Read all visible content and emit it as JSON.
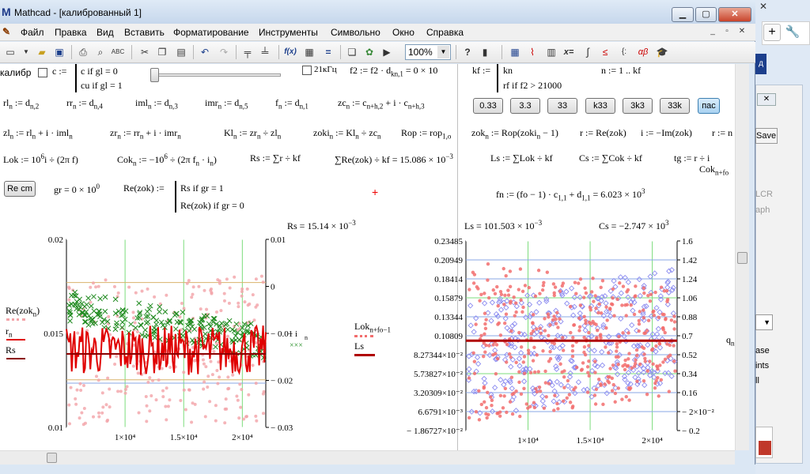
{
  "window": {
    "app_icon": "M",
    "title": "Mathcad - [калиброванный 1]",
    "min_label": "▁",
    "max_label": "▢",
    "close_label": "✕"
  },
  "menu": {
    "doc_icon": "✎",
    "items": [
      "Файл",
      "Правка",
      "Вид",
      "Вставить",
      "Форматирование",
      "Инструменты",
      "Символьно",
      "Окно",
      "Справка"
    ],
    "mdi_buttons": [
      "_",
      "▫",
      "✕"
    ]
  },
  "toolbar": {
    "zoom": "100%",
    "icons": [
      "new-doc-icon",
      "open-icon",
      "save-icon",
      "print-icon",
      "print-preview-icon",
      "spell-check-icon",
      "cut-icon",
      "copy-icon",
      "paste-icon",
      "undo-icon",
      "redo-icon",
      "align-icon",
      "align-down-icon",
      "insert-function-icon",
      "insert-unit-icon",
      "calculate-icon",
      "component-icon",
      "resource-icon",
      "help-icon",
      "run-icon",
      "calculator-icon",
      "graph-icon",
      "matrix-icon",
      "evaluation-icon",
      "calculus-icon",
      "boolean-icon",
      "programming-icon",
      "greek-icon",
      "symbolic-icon"
    ]
  },
  "sheet": {
    "kalibr_label": "калибр",
    "c_def_1": "c if gl = 0",
    "c_def_2": "cu if gl = 1",
    "c_prefix": "c :=",
    "check_21": "21кГц",
    "f2_def": "f2 := f2 · d",
    "f2_sub": "kn,1",
    "f2_tail": "= 0 × 10",
    "kf_prefix": "kf :=",
    "kf_def_1": "kn",
    "kf_def_2": "rf if f2 > 21000",
    "n_range": "n := 1 .. kf",
    "row2": {
      "rl": "rl",
      "rl_def": ":= d",
      "rr": "rr",
      "rr_def": ":= d",
      "iml": "iml",
      "iml_def": ":= d",
      "imr": "imr",
      "imr_def": ":= d",
      "f": "f",
      "f_def": ":= d",
      "zc": "zc",
      "zc_def": ":= c",
      "zc_mid": "+ i · c",
      "sub_n2": "n,2",
      "sub_n4": "n,4",
      "sub_n3": "n,3",
      "sub_n5": "n,5",
      "sub_n1": "n,1",
      "sub_nh2": "n+h,2",
      "sub_nh3": "n+h,3"
    },
    "buttons": [
      "0.33",
      "3.3",
      "33",
      "k33",
      "3k3",
      "33k",
      "пас"
    ],
    "row3": {
      "zl": "zl",
      "zl_def": ":= rl",
      "zl_tail": "+ i · iml",
      "zr": "zr",
      "zr_def": ":= rr",
      "zr_tail": "+ i · imr",
      "kl": "Kl",
      "kl_def": ":= zr",
      "kl_tail": "÷ zl",
      "zoki": "zoki",
      "zoki_def": ":= Kl",
      "zoki_tail": "÷ zc",
      "rop": "Rop := rop",
      "rop_sub": "1,o",
      "zok": "zok",
      "zok_def": ":= Rop(zoki",
      "zok_tail": "− 1)",
      "r_def": "r := Re(zok)",
      "i_def": "i := −Im(zok)",
      "rr2": "r :=",
      "n": "n"
    },
    "row4": {
      "lok": "Lok := 10",
      "lok_exp": "6",
      "lok_tail": "i ÷ (2π f)",
      "cok": "Cok",
      "cok_def": ":= −10",
      "cok_exp": "6",
      "cok_tail": "÷ (2π f",
      "cok_end": "· i",
      "rs": "Rs := ∑r ÷ kf",
      "sum_re": "∑Re(zok) ÷ kf = 15.086 × 10",
      "sum_re_exp": "−3",
      "ls": "Ls := ∑Lok ÷ kf",
      "cs": "Cs := ∑Cok ÷ kf",
      "tg": "tg := r ÷ i",
      "cok_sub": "Cok",
      "cok_sub_idx": "n+fo"
    },
    "re_button": "Re cm",
    "gr_def": "gr = 0 × 10",
    "gr_exp": "0",
    "re_func": "Re(zok) :=",
    "re_case_1": "Rs if gr = 1",
    "re_case_2": "Re(zok) if gr = 0",
    "fn_def": "fn := (fo − 1) · c",
    "fn_sub1": "1,1",
    "fn_mid": "+ d",
    "fn_sub2": "1,1",
    "fn_tail": "= 6.023 × 10",
    "fn_exp": "3",
    "rs_result": "Rs = 15.14 × 10",
    "rs_exp": "−3",
    "ls_result": "Ls = 101.503 × 10",
    "ls_exp": "−3",
    "cs_result": "Cs = −2.747 × 10",
    "cs_exp": "3"
  },
  "chart_data": [
    {
      "type": "scatter",
      "legend_left": [
        "Re(zok_n)",
        "r_n",
        "Rs"
      ],
      "legend_right": [
        "− i_n"
      ],
      "legend_left_labels": {
        "re": "Re(zok",
        "re_sub": "n",
        "re_tail": ")",
        "r": "r",
        "r_sub": "n",
        "rs": "Rs"
      },
      "legend_right_labels": {
        "i": "− i",
        "i_sub": "n"
      },
      "y_left_ticks": [
        "0.02",
        "0.015",
        "0.01"
      ],
      "y_right_ticks": [
        "0.01",
        "0",
        "− 0.01",
        "− 0.02",
        "− 0.03"
      ],
      "x_ticks": [
        "1×10⁴",
        "1.5×10⁴",
        "2×10⁴"
      ],
      "ylim_left": [
        0.0085,
        0.0255
      ],
      "ylim_right": [
        -0.03,
        0.01
      ],
      "xlim": [
        5000,
        22000
      ],
      "series": [
        {
          "name": "Re(zok_n)",
          "style": "pink dots",
          "color": "#f3a3a8"
        },
        {
          "name": "r_n",
          "style": "red line",
          "color": "#e00000"
        },
        {
          "name": "Rs",
          "style": "dark red line",
          "color": "#8b0000",
          "value": 0.01514
        },
        {
          "name": "− i_n",
          "style": "green crosses",
          "color": "#1f8a1f"
        }
      ],
      "grid_lines_x": [
        10000,
        15000,
        20000
      ]
    },
    {
      "type": "scatter",
      "legend_left": [
        "Lok_n+fo−1",
        "Ls"
      ],
      "legend_left_labels": {
        "lok": "Lok",
        "lok_sub": "n+fo−1",
        "ls": "Ls"
      },
      "legend_right": [
        "q_n"
      ],
      "legend_right_labels": {
        "q": "q",
        "q_sub": "n"
      },
      "y_left_ticks": [
        "0.23485",
        "0.20949",
        "0.18414",
        "0.15879",
        "0.13344",
        "0.10809",
        "8.27344×10⁻²",
        "5.73827×10⁻²",
        "3.20309×10⁻²",
        "6.6791×10⁻³",
        "− 1.86727×10⁻²"
      ],
      "y_right_ticks": [
        "1.6",
        "1.42",
        "1.24",
        "1.06",
        "0.88",
        "0.7",
        "0.52",
        "0.34",
        "0.16",
        "− 2×10⁻²",
        "− 0.2"
      ],
      "x_ticks": [
        "1×10⁴",
        "1.5×10⁴",
        "2×10⁴"
      ],
      "xlim": [
        5000,
        22000
      ],
      "series": [
        {
          "name": "Lok_n+fo−1",
          "style": "red dots",
          "color": "#f26d6d"
        },
        {
          "name": "Ls",
          "style": "dark red line",
          "color": "#b00000",
          "value": 0.1015
        },
        {
          "name": "q_n",
          "style": "blue diamonds",
          "color": "#8c8cf0"
        }
      ],
      "grid_lines_x": [
        10000,
        15000,
        20000
      ]
    }
  ],
  "right_panel": {
    "tag": "д",
    "close": "✕",
    "save": "Save",
    "lcr": "LCR",
    "aph": "aph",
    "ase": "ase",
    "ints": "ints",
    "ll": "ll",
    "close_top": "✕"
  }
}
